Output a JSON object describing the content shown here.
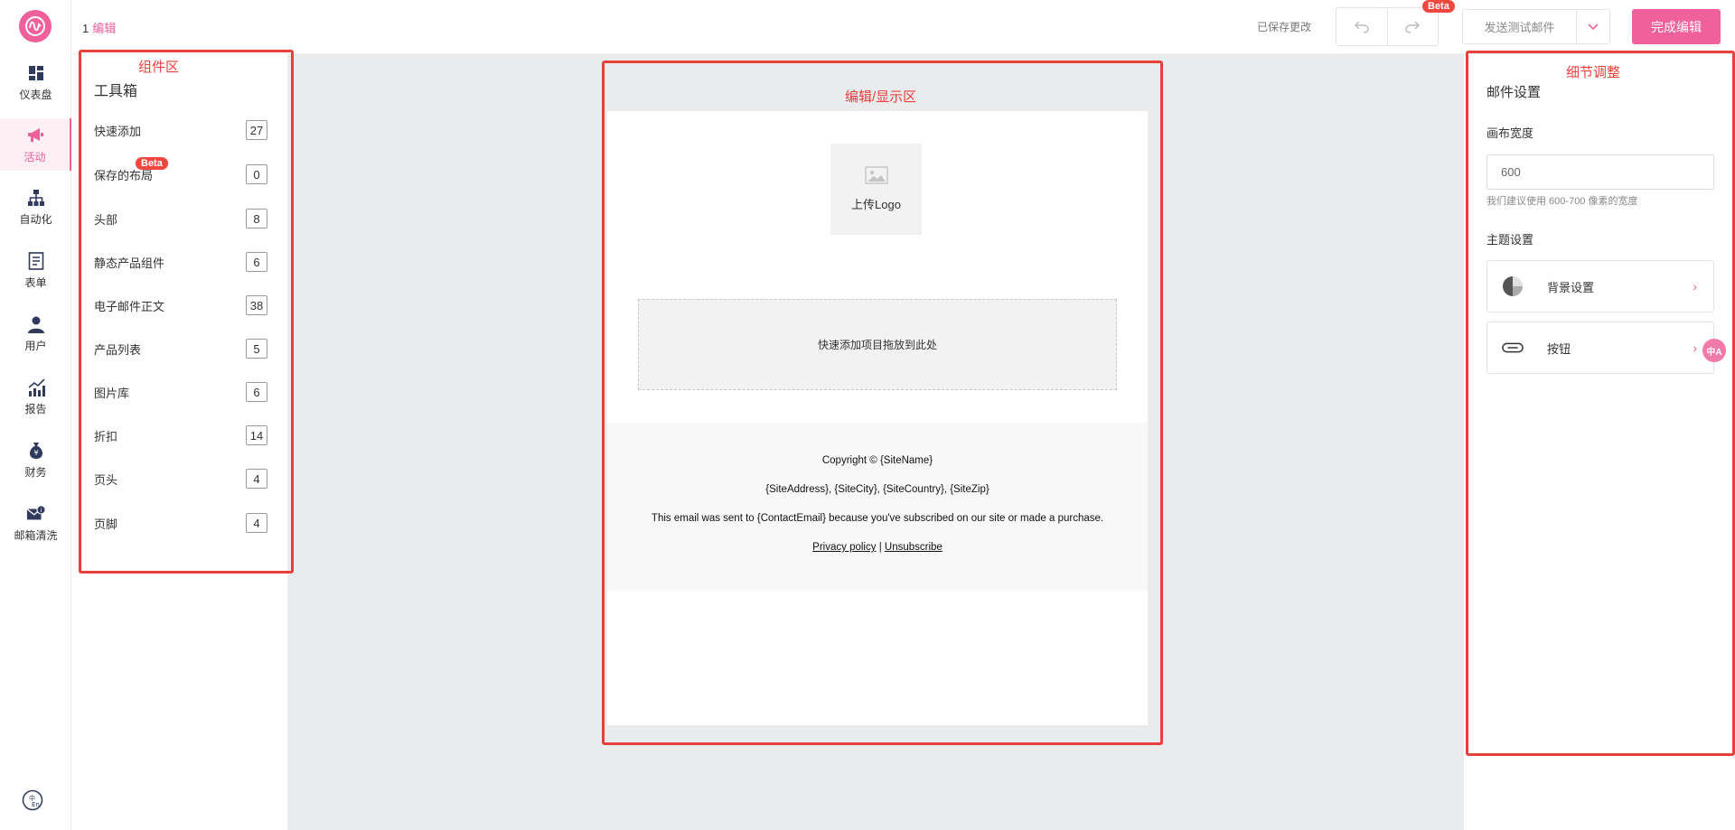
{
  "nav": {
    "items": [
      {
        "label": "仪表盘",
        "icon": "dashboard-icon"
      },
      {
        "label": "活动",
        "icon": "megaphone-icon"
      },
      {
        "label": "自动化",
        "icon": "sitemap-icon"
      },
      {
        "label": "表单",
        "icon": "form-icon"
      },
      {
        "label": "用户",
        "icon": "user-icon"
      },
      {
        "label": "报告",
        "icon": "chart-icon"
      },
      {
        "label": "财务",
        "icon": "money-bag-icon"
      },
      {
        "label": "邮箱清洗",
        "icon": "mail-clean-icon"
      }
    ],
    "active_index": 1
  },
  "header": {
    "step": "1",
    "step_label": "编辑",
    "saved_text": "已保存更改",
    "beta": "Beta",
    "send_test": "发送测试邮件",
    "done": "完成编辑"
  },
  "annotations": {
    "components": "组件区",
    "editor": "编辑/显示区",
    "details": "细节调整"
  },
  "toolbox": {
    "title": "工具箱",
    "beta": "Beta",
    "items": [
      {
        "label": "快速添加",
        "count": "27"
      },
      {
        "label": "保存的布局",
        "count": "0"
      },
      {
        "label": "头部",
        "count": "8"
      },
      {
        "label": "静态产品组件",
        "count": "6"
      },
      {
        "label": "电子邮件正文",
        "count": "38"
      },
      {
        "label": "产品列表",
        "count": "5"
      },
      {
        "label": "图片库",
        "count": "6"
      },
      {
        "label": "折扣",
        "count": "14"
      },
      {
        "label": "页头",
        "count": "4"
      },
      {
        "label": "页脚",
        "count": "4"
      }
    ]
  },
  "email": {
    "logo_label": "上传Logo",
    "drop_text": "快速添加项目拖放到此处",
    "footer": {
      "copyright": "Copyright © {SiteName}",
      "address": "{SiteAddress}, {SiteCity}, {SiteCountry}, {SiteZip}",
      "sent_to": "This email was sent to {ContactEmail} because you've subscribed on our site or made a purchase.",
      "privacy": "Privacy policy",
      "separator": "|",
      "unsubscribe": "Unsubscribe"
    }
  },
  "settings": {
    "title": "邮件设置",
    "canvas_width_label": "画布宽度",
    "canvas_width_value": "600",
    "canvas_width_hint": "我们建议使用 600-700 像素的宽度",
    "theme_label": "主题设置",
    "theme_items": [
      {
        "label": "背景设置",
        "icon": "background-icon"
      },
      {
        "label": "按钮",
        "icon": "button-icon"
      }
    ],
    "translate_badge": "中A"
  },
  "colors": {
    "accent": "#f0609a",
    "annotation": "#e8413c",
    "beta": "#f0473f"
  }
}
